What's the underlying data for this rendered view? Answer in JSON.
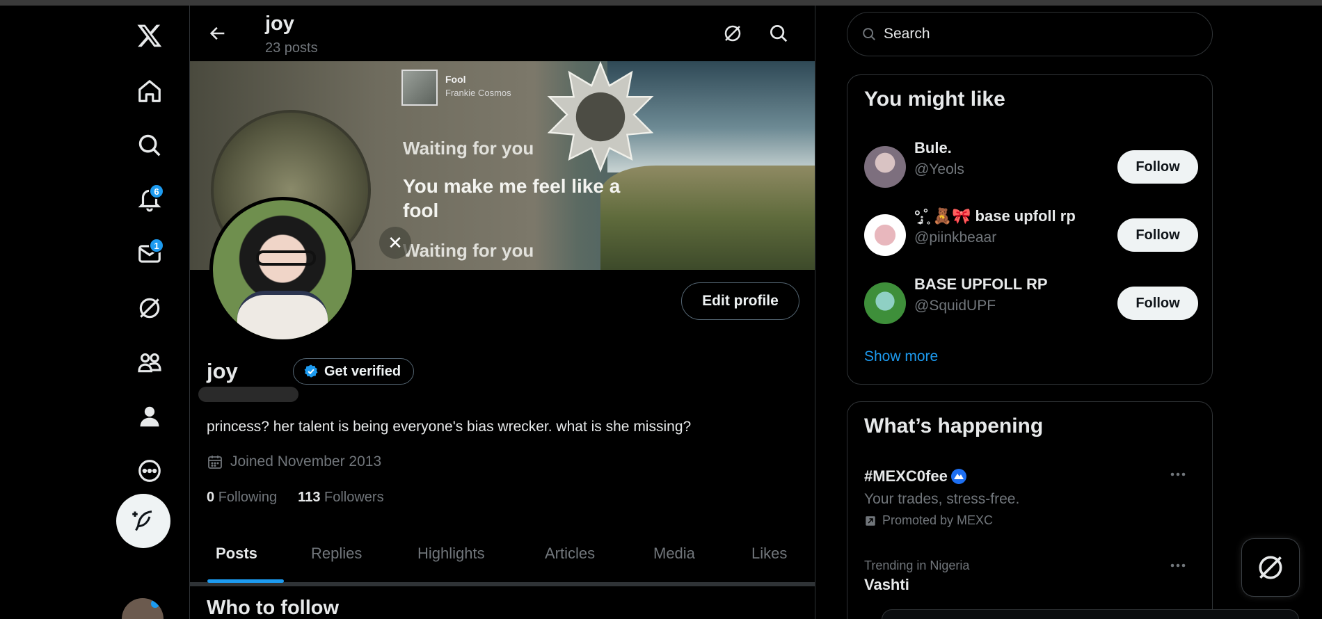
{
  "colors": {
    "accent": "#1d9bf0",
    "background": "#000000",
    "border": "#2f3336",
    "muted": "#71767b"
  },
  "nav": {
    "items": [
      {
        "icon": "x-logo-icon"
      },
      {
        "icon": "home-icon"
      },
      {
        "icon": "search-icon"
      },
      {
        "icon": "bell-icon",
        "badge": "6"
      },
      {
        "icon": "mail-icon",
        "badge": "1"
      },
      {
        "icon": "grok-icon"
      },
      {
        "icon": "communities-icon"
      },
      {
        "icon": "profile-icon"
      },
      {
        "icon": "more-circle-icon"
      }
    ],
    "compose_icon": "feather-plus-icon"
  },
  "header": {
    "name": "joy",
    "posts": "23 posts"
  },
  "banner": {
    "song_title": "Fool",
    "song_artist": "Frankie Cosmos",
    "lyric1": "Waiting for you",
    "lyric2": "You make me feel like a fool",
    "lyric3": "Waiting for you"
  },
  "profile": {
    "edit_label": "Edit profile",
    "name": "joy",
    "get_verified": "Get verified",
    "bio": "princess? her talent is being everyone's bias wrecker. what is she missing?",
    "joined": "Joined November 2013",
    "following_count": "0",
    "following_label": "Following",
    "followers_count": "113",
    "followers_label": "Followers"
  },
  "tabs": [
    "Posts",
    "Replies",
    "Highlights",
    "Articles",
    "Media",
    "Likes"
  ],
  "who_to_follow": "Who to follow",
  "search": {
    "placeholder": "Search"
  },
  "you_might_like": {
    "title": "You might like",
    "users": [
      {
        "name": "Bule.",
        "handle": "@Yeols",
        "button": "Follow"
      },
      {
        "name": "°̥⨾̱˚̥ 🧸🎀 base upfoll rp",
        "handle": "@piinkbeaar",
        "button": "Follow"
      },
      {
        "name": "BASE UPFOLL RP",
        "handle": "@SquidUPF",
        "button": "Follow"
      }
    ],
    "show_more": "Show more"
  },
  "whats_happening": {
    "title": "What’s happening",
    "promo": {
      "tag": "#MEXC0fee",
      "subtitle": "Your trades, stress-free.",
      "promoted": "Promoted by MEXC"
    },
    "trend": {
      "context": "Trending in Nigeria",
      "name": "Vashti"
    }
  }
}
